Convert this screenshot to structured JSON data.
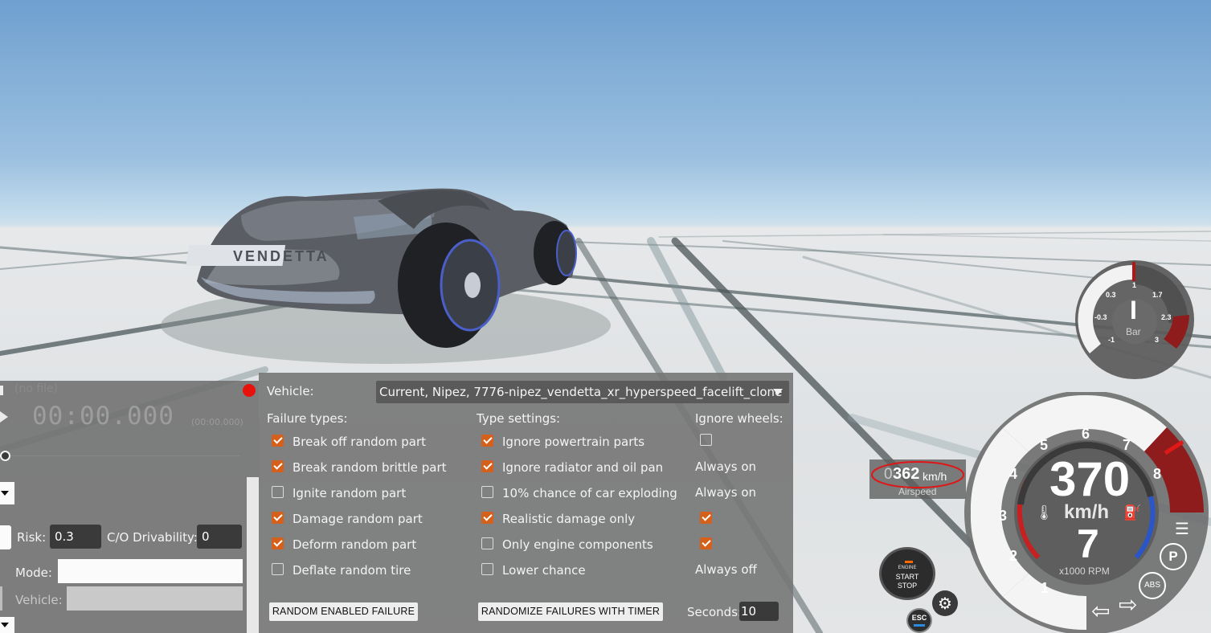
{
  "left_panel": {
    "top_label": "(no file)",
    "timer": "00:00.000",
    "timer_small": "(00:00.000)",
    "risk_label": "Risk:",
    "risk_value": "0.3",
    "co_label": "C/O Drivability:",
    "co_value": "0",
    "mode_label": "Mode:",
    "mode_value": "",
    "vehicle_label": "Vehicle:",
    "vehicle_value": ""
  },
  "failure_panel": {
    "vehicle_label": "Vehicle:",
    "vehicle_selected": "Current, Nipez, 7776-nipez_vendetta_xr_hyperspeed_facelift_clone",
    "failure_types_header": "Failure types:",
    "type_settings_header": "Type settings:",
    "ignore_wheels_header": "Ignore wheels:",
    "failure_types": [
      {
        "label": "Break off random part",
        "checked": true
      },
      {
        "label": "Break random brittle part",
        "checked": true
      },
      {
        "label": "Ignite random part",
        "checked": false
      },
      {
        "label": "Damage random part",
        "checked": true
      },
      {
        "label": "Deform random part",
        "checked": true
      },
      {
        "label": "Deflate random tire",
        "checked": false
      }
    ],
    "type_settings": [
      {
        "label": "Ignore powertrain parts",
        "checked": true
      },
      {
        "label": "Ignore radiator and oil pan",
        "checked": true
      },
      {
        "label": "10% chance of car exploding",
        "checked": false
      },
      {
        "label": "Realistic damage only",
        "checked": true
      },
      {
        "label": "Only engine components",
        "checked": false
      },
      {
        "label": "Lower chance",
        "checked": false
      }
    ],
    "ignore_wheels": {
      "row1_checked": false,
      "row2_text": "Always on",
      "row3_text": "Always on",
      "row4_checked": true,
      "row5_checked": true,
      "row6_text": "Always off"
    },
    "random_button": "RANDOM ENABLED FAILURE",
    "timer_button": "RANDOMIZE FAILURES WITH TIMER",
    "seconds_label": "Seconds:",
    "seconds_value": "10",
    "status_dot_color": "#e8120c"
  },
  "airspeed": {
    "prefix": "0",
    "value": "362",
    "unit": "km/h",
    "label": "Airspeed"
  },
  "boost_gauge": {
    "ticks": [
      "0.3",
      "1",
      "1.7",
      "-0.3",
      "2.3",
      "-1",
      "3"
    ],
    "gear_marker": "I",
    "unit": "Bar"
  },
  "speedometer": {
    "speed": "370",
    "unit": "km/h",
    "gear": "7",
    "rpm_label": "x1000 RPM",
    "rpm_ticks": [
      "1",
      "2",
      "3",
      "4",
      "5",
      "6",
      "7",
      "8"
    ],
    "redline_color": "#8e1c1c"
  },
  "controls": {
    "engine_label_1": "ENGINE",
    "engine_label_2": "START",
    "engine_label_3": "STOP",
    "esc_label": "ESC",
    "abs_label": "ABS",
    "park_label": "P"
  },
  "car": {
    "badge": "VENDETTA"
  }
}
